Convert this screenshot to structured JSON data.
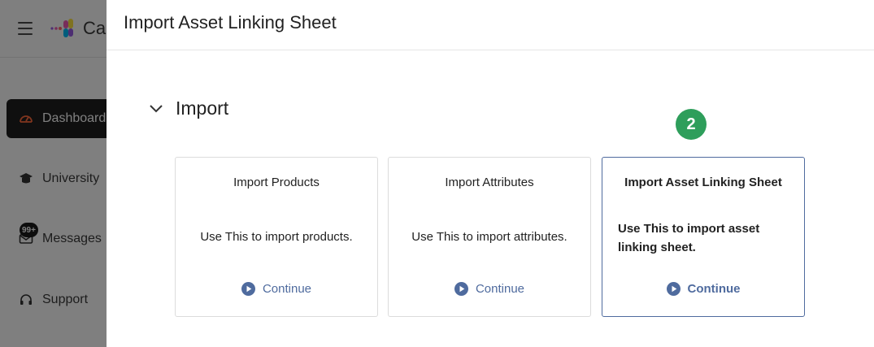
{
  "background_app": {
    "brand_label": "Ca",
    "nav": [
      {
        "label": "Dashboard",
        "icon": "speedometer-icon",
        "active": true
      },
      {
        "label": "University",
        "icon": "graduation-cap-icon",
        "active": false
      },
      {
        "label": "Messages",
        "icon": "envelope-icon",
        "badge": "99+",
        "active": false
      },
      {
        "label": "Support",
        "icon": "headset-icon",
        "active": false
      }
    ]
  },
  "drawer": {
    "title": "Import Asset Linking Sheet",
    "section": {
      "title": "Import",
      "toggle_icon": "chevron-down-icon",
      "step_badge": "2",
      "cards": [
        {
          "title": "Import Products",
          "description": "Use This to import products.",
          "action": "Continue",
          "selected": false
        },
        {
          "title": "Import Attributes",
          "description": "Use This to import attributes.",
          "action": "Continue",
          "selected": false
        },
        {
          "title": "Import Asset Linking Sheet",
          "description": "Use This to import asset linking sheet.",
          "action": "Continue",
          "selected": true
        }
      ]
    }
  },
  "colors": {
    "accent": "#4f6b9e",
    "step_badge": "#2e9e5b",
    "overlay": "rgba(0,0,0,0.5)",
    "active_nav": "#1f1f1f"
  }
}
